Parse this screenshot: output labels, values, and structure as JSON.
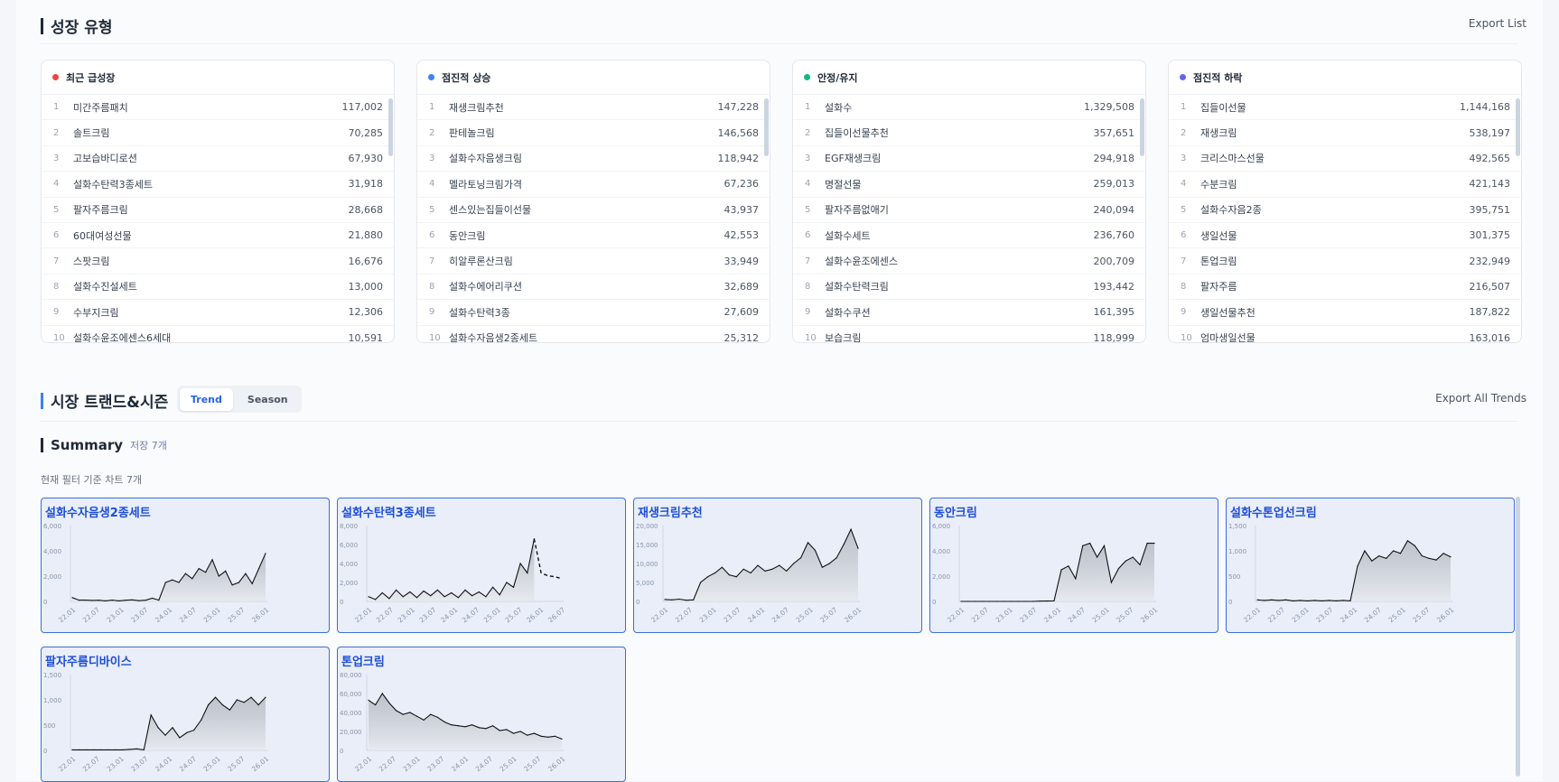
{
  "growth": {
    "title": "성장 유형",
    "export_label": "Export List",
    "cards": [
      {
        "label": "최근 급성장",
        "color": "#ef4444",
        "rows": [
          {
            "rank": "1",
            "keyword": "미간주름패치",
            "value": "117,002"
          },
          {
            "rank": "2",
            "keyword": "솔트크림",
            "value": "70,285"
          },
          {
            "rank": "3",
            "keyword": "고보습바디로션",
            "value": "67,930"
          },
          {
            "rank": "4",
            "keyword": "설화수탄력3종세트",
            "value": "31,918"
          },
          {
            "rank": "5",
            "keyword": "팔자주름크림",
            "value": "28,668"
          },
          {
            "rank": "6",
            "keyword": "60대여성선물",
            "value": "21,880"
          },
          {
            "rank": "7",
            "keyword": "스팟크림",
            "value": "16,676"
          },
          {
            "rank": "8",
            "keyword": "설화수진설세트",
            "value": "13,000"
          },
          {
            "rank": "9",
            "keyword": "수부지크림",
            "value": "12,306"
          },
          {
            "rank": "10",
            "keyword": "설화수윤조에센스6세대",
            "value": "10,591"
          }
        ]
      },
      {
        "label": "점진적 상승",
        "color": "#3b82f6",
        "rows": [
          {
            "rank": "1",
            "keyword": "재생크림추천",
            "value": "147,228"
          },
          {
            "rank": "2",
            "keyword": "판테놀크림",
            "value": "146,568"
          },
          {
            "rank": "3",
            "keyword": "설화수자음생크림",
            "value": "118,942"
          },
          {
            "rank": "4",
            "keyword": "멜라토닝크림가격",
            "value": "67,236"
          },
          {
            "rank": "5",
            "keyword": "센스있는집들이선물",
            "value": "43,937"
          },
          {
            "rank": "6",
            "keyword": "동안크림",
            "value": "42,553"
          },
          {
            "rank": "7",
            "keyword": "히알루론산크림",
            "value": "33,949"
          },
          {
            "rank": "8",
            "keyword": "설화수에어리쿠션",
            "value": "32,689"
          },
          {
            "rank": "9",
            "keyword": "설화수탄력3종",
            "value": "27,609"
          },
          {
            "rank": "10",
            "keyword": "설화수자음생2종세트",
            "value": "25,312"
          }
        ]
      },
      {
        "label": "안정/유지",
        "color": "#10b981",
        "rows": [
          {
            "rank": "1",
            "keyword": "설화수",
            "value": "1,329,508"
          },
          {
            "rank": "2",
            "keyword": "집들이선물추천",
            "value": "357,651"
          },
          {
            "rank": "3",
            "keyword": "EGF재생크림",
            "value": "294,918"
          },
          {
            "rank": "4",
            "keyword": "명절선물",
            "value": "259,013"
          },
          {
            "rank": "5",
            "keyword": "팔자주름없애기",
            "value": "240,094"
          },
          {
            "rank": "6",
            "keyword": "설화수세트",
            "value": "236,760"
          },
          {
            "rank": "7",
            "keyword": "설화수윤조에센스",
            "value": "200,709"
          },
          {
            "rank": "8",
            "keyword": "설화수탄력크림",
            "value": "193,442"
          },
          {
            "rank": "9",
            "keyword": "설화수쿠션",
            "value": "161,395"
          },
          {
            "rank": "10",
            "keyword": "보습크림",
            "value": "118,999"
          }
        ]
      },
      {
        "label": "점진적 하락",
        "color": "#6366f1",
        "rows": [
          {
            "rank": "1",
            "keyword": "집들이선물",
            "value": "1,144,168"
          },
          {
            "rank": "2",
            "keyword": "재생크림",
            "value": "538,197"
          },
          {
            "rank": "3",
            "keyword": "크리스마스선물",
            "value": "492,565"
          },
          {
            "rank": "4",
            "keyword": "수분크림",
            "value": "421,143"
          },
          {
            "rank": "5",
            "keyword": "설화수자음2종",
            "value": "395,751"
          },
          {
            "rank": "6",
            "keyword": "생일선물",
            "value": "301,375"
          },
          {
            "rank": "7",
            "keyword": "톤업크림",
            "value": "232,949"
          },
          {
            "rank": "8",
            "keyword": "팔자주름",
            "value": "216,507"
          },
          {
            "rank": "9",
            "keyword": "생일선물추천",
            "value": "187,822"
          },
          {
            "rank": "10",
            "keyword": "엄마생일선물",
            "value": "163,016"
          }
        ]
      }
    ]
  },
  "trend": {
    "title": "시장 트랜드&시즌",
    "tabs": [
      "Trend",
      "Season"
    ],
    "active_tab": "Trend",
    "export_label": "Export All Trends"
  },
  "summary": {
    "title": "Summary",
    "saved_label": "저장 7개",
    "note": "현재 필터 기준 차트 7개"
  },
  "chart_data": [
    {
      "type": "area",
      "title": "설화수자음생2종세트",
      "x": [
        "22.01",
        "22.07",
        "23.01",
        "23.07",
        "24.01",
        "24.07",
        "25.01",
        "25.07",
        "26.01"
      ],
      "ylim": [
        0,
        6000
      ],
      "yticks": [
        "6,000",
        "4,000",
        "2,000",
        "0"
      ],
      "values": [
        300,
        100,
        100,
        80,
        90,
        40,
        100,
        40,
        90,
        120,
        60,
        90,
        250,
        100,
        1500,
        1700,
        1500,
        2200,
        1800,
        2600,
        2300,
        3300,
        2000,
        2400,
        1300,
        1500,
        2200,
        1400,
        2600,
        3800
      ]
    },
    {
      "type": "area",
      "title": "설화수탄력3종세트",
      "x": [
        "22.01",
        "22.07",
        "23.01",
        "23.07",
        "24.01",
        "24.07",
        "25.01",
        "25.07",
        "26.01",
        "26.07"
      ],
      "ylim": [
        0,
        8000
      ],
      "yticks": [
        "8,000",
        "6,000",
        "4,000",
        "2,000",
        "0"
      ],
      "values": [
        500,
        200,
        900,
        300,
        1200,
        500,
        1000,
        400,
        1100,
        600,
        1200,
        500,
        900,
        400,
        1200,
        600,
        1000,
        500,
        1500,
        700,
        2000,
        1500,
        4000,
        3000,
        6600
      ],
      "forecast": [
        6600,
        3000,
        2700,
        2600,
        2400
      ]
    },
    {
      "type": "area",
      "title": "재생크림추천",
      "x": [
        "22.01",
        "22.07",
        "23.01",
        "23.07",
        "24.01",
        "24.07",
        "25.01",
        "25.07",
        "26.01"
      ],
      "ylim": [
        0,
        20000
      ],
      "yticks": [
        "20,000",
        "15,000",
        "10,000",
        "5,000",
        "0"
      ],
      "values": [
        500,
        400,
        600,
        300,
        400,
        5000,
        6500,
        7500,
        9000,
        7000,
        6500,
        8500,
        7500,
        9500,
        8000,
        8500,
        9500,
        8000,
        10000,
        11500,
        15500,
        13500,
        9000,
        10000,
        11500,
        15000,
        19000,
        14000
      ]
    },
    {
      "type": "area",
      "title": "동안크림",
      "x": [
        "22.01",
        "22.07",
        "23.01",
        "23.07",
        "24.01",
        "24.07",
        "25.01",
        "25.07",
        "26.01"
      ],
      "ylim": [
        0,
        6000
      ],
      "yticks": [
        "6,000",
        "4,000",
        "2,000",
        "0"
      ],
      "values": [
        0,
        0,
        0,
        0,
        0,
        0,
        0,
        0,
        0,
        0,
        0,
        20,
        30,
        40,
        2500,
        2800,
        1800,
        4400,
        4600,
        3500,
        4400,
        1500,
        2600,
        3200,
        3500,
        2900,
        4600,
        4600
      ]
    },
    {
      "type": "area",
      "title": "설화수톤업선크림",
      "x": [
        "22.01",
        "22.07",
        "23.01",
        "23.07",
        "24.01",
        "24.07",
        "25.01",
        "25.07",
        "26.01"
      ],
      "ylim": [
        0,
        1500
      ],
      "yticks": [
        "1,500",
        "1,000",
        "500",
        "0"
      ],
      "values": [
        30,
        20,
        30,
        20,
        30,
        10,
        20,
        10,
        20,
        10,
        20,
        10,
        20,
        10,
        700,
        1000,
        800,
        900,
        850,
        1000,
        950,
        1200,
        1100,
        900,
        850,
        820,
        950,
        880
      ]
    },
    {
      "type": "area",
      "title": "팔자주름디바이스",
      "x": [
        "22.01",
        "22.07",
        "23.01",
        "23.07",
        "24.01",
        "24.07",
        "25.01",
        "25.07",
        "26.01"
      ],
      "ylim": [
        0,
        1500
      ],
      "yticks": [
        "1,500",
        "1,000",
        "500",
        "0"
      ],
      "values": [
        10,
        10,
        10,
        10,
        10,
        10,
        10,
        10,
        20,
        30,
        10,
        700,
        450,
        300,
        450,
        250,
        350,
        400,
        600,
        900,
        1050,
        900,
        800,
        1000,
        950,
        1050,
        900,
        1050
      ]
    },
    {
      "type": "area",
      "title": "톤업크림",
      "x": [
        "22.01",
        "22.07",
        "23.01",
        "23.07",
        "24.01",
        "24.07",
        "25.01",
        "25.07",
        "26.01"
      ],
      "ylim": [
        0,
        80000
      ],
      "yticks": [
        "80,000",
        "60,000",
        "40,000",
        "20,000",
        "0"
      ],
      "values": [
        53000,
        48000,
        60000,
        50000,
        42000,
        38000,
        40000,
        36000,
        32000,
        38000,
        35000,
        30000,
        27000,
        26000,
        25000,
        27000,
        24000,
        23000,
        26000,
        21000,
        22000,
        18000,
        20000,
        16000,
        18000,
        15000,
        14000,
        15000,
        12000
      ]
    }
  ]
}
